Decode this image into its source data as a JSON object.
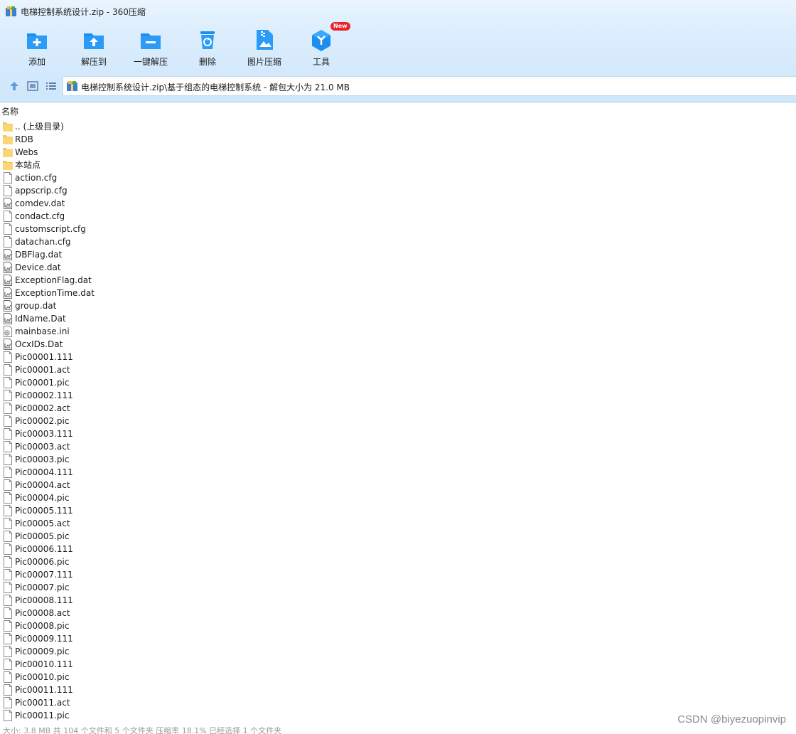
{
  "window": {
    "title": "电梯控制系统设计.zip - 360压缩"
  },
  "toolbar": {
    "buttons": [
      {
        "label": "添加",
        "icon": "add-icon"
      },
      {
        "label": "解压到",
        "icon": "extract-to-icon"
      },
      {
        "label": "一键解压",
        "icon": "one-click-extract-icon"
      },
      {
        "label": "删除",
        "icon": "delete-icon"
      },
      {
        "label": "图片压缩",
        "icon": "image-compress-icon"
      },
      {
        "label": "工具",
        "icon": "tools-icon",
        "badge": "New"
      }
    ]
  },
  "path": {
    "text": "电梯控制系统设计.zip\\基于组态的电梯控制系统 - 解包大小为 21.0 MB"
  },
  "list": {
    "column_name": "名称",
    "items": [
      {
        "name": ".. (上级目录)",
        "type": "folder"
      },
      {
        "name": "RDB",
        "type": "folder"
      },
      {
        "name": "Webs",
        "type": "folder"
      },
      {
        "name": "本站点",
        "type": "folder"
      },
      {
        "name": "action.cfg",
        "type": "file"
      },
      {
        "name": "appscrip.cfg",
        "type": "file"
      },
      {
        "name": "comdev.dat",
        "type": "data"
      },
      {
        "name": "condact.cfg",
        "type": "file"
      },
      {
        "name": "customscript.cfg",
        "type": "file"
      },
      {
        "name": "datachan.cfg",
        "type": "file"
      },
      {
        "name": "DBFlag.dat",
        "type": "data"
      },
      {
        "name": "Device.dat",
        "type": "data"
      },
      {
        "name": "ExceptionFlag.dat",
        "type": "data"
      },
      {
        "name": "ExceptionTime.dat",
        "type": "data"
      },
      {
        "name": "group.dat",
        "type": "data"
      },
      {
        "name": "IdName.Dat",
        "type": "data"
      },
      {
        "name": "mainbase.ini",
        "type": "ini"
      },
      {
        "name": "OcxIDs.Dat",
        "type": "data"
      },
      {
        "name": "Pic00001.111",
        "type": "file"
      },
      {
        "name": "Pic00001.act",
        "type": "file"
      },
      {
        "name": "Pic00001.pic",
        "type": "file"
      },
      {
        "name": "Pic00002.111",
        "type": "file"
      },
      {
        "name": "Pic00002.act",
        "type": "file"
      },
      {
        "name": "Pic00002.pic",
        "type": "file"
      },
      {
        "name": "Pic00003.111",
        "type": "file"
      },
      {
        "name": "Pic00003.act",
        "type": "file"
      },
      {
        "name": "Pic00003.pic",
        "type": "file"
      },
      {
        "name": "Pic00004.111",
        "type": "file"
      },
      {
        "name": "Pic00004.act",
        "type": "file"
      },
      {
        "name": "Pic00004.pic",
        "type": "file"
      },
      {
        "name": "Pic00005.111",
        "type": "file"
      },
      {
        "name": "Pic00005.act",
        "type": "file"
      },
      {
        "name": "Pic00005.pic",
        "type": "file"
      },
      {
        "name": "Pic00006.111",
        "type": "file"
      },
      {
        "name": "Pic00006.pic",
        "type": "file"
      },
      {
        "name": "Pic00007.111",
        "type": "file"
      },
      {
        "name": "Pic00007.pic",
        "type": "file"
      },
      {
        "name": "Pic00008.111",
        "type": "file"
      },
      {
        "name": "Pic00008.act",
        "type": "file"
      },
      {
        "name": "Pic00008.pic",
        "type": "file"
      },
      {
        "name": "Pic00009.111",
        "type": "file"
      },
      {
        "name": "Pic00009.pic",
        "type": "file"
      },
      {
        "name": "Pic00010.111",
        "type": "file"
      },
      {
        "name": "Pic00010.pic",
        "type": "file"
      },
      {
        "name": "Pic00011.111",
        "type": "file"
      },
      {
        "name": "Pic00011.act",
        "type": "file"
      },
      {
        "name": "Pic00011.pic",
        "type": "file"
      }
    ]
  },
  "status": {
    "text": "大小: 3.8 MB 共 104 个文件和 5 个文件夹 压缩率 18.1% 已经选择 1 个文件夹"
  },
  "watermark": "CSDN @biyezuopinvip",
  "colors": {
    "toolbar_blue": "#1c8ef0",
    "folder_yellow": "#f8d774",
    "badge_red": "#e8232b"
  }
}
